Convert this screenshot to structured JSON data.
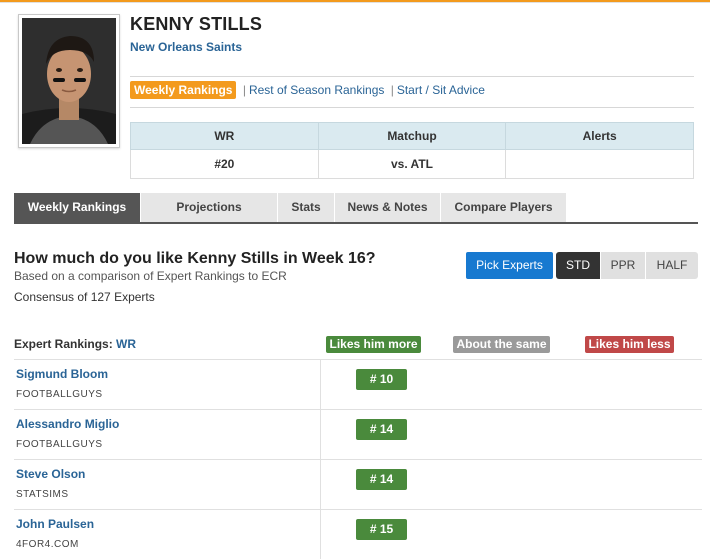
{
  "player": {
    "name": "KENNY STILLS",
    "team": "New Orleans Saints"
  },
  "sub_nav": {
    "active": "Weekly Rankings",
    "links": [
      "Rest of Season Rankings",
      "Start / Sit Advice"
    ],
    "separator": "|"
  },
  "info_table": {
    "headers": [
      "WR",
      "Matchup",
      "Alerts"
    ],
    "values": [
      "#20",
      "vs. ATL",
      ""
    ]
  },
  "tabs": [
    "Weekly Rankings",
    "Projections",
    "Stats",
    "News & Notes",
    "Compare Players"
  ],
  "question": "How much do you like Kenny Stills in Week 16?",
  "based_on": "Based on a comparison of Expert Rankings to ECR",
  "consensus": "Consensus of 127 Experts",
  "pick_experts_label": "Pick Experts",
  "scoring": [
    "STD",
    "PPR",
    "HALF"
  ],
  "experts_header": {
    "label": "Expert Rankings:",
    "position": "WR"
  },
  "badges": {
    "more": "Likes him more",
    "same": "About the same",
    "less": "Likes him less"
  },
  "experts": [
    {
      "name": "Sigmund Bloom",
      "site": "FOOTBALLGUYS",
      "rank": "# 10"
    },
    {
      "name": "Alessandro Miglio",
      "site": "FOOTBALLGUYS",
      "rank": "# 14"
    },
    {
      "name": "Steve Olson",
      "site": "STATSIMS",
      "rank": "# 14"
    },
    {
      "name": "John Paulsen",
      "site": "4FOR4.COM",
      "rank": "# 15"
    }
  ],
  "colors": {
    "accent_orange": "#f39a1d",
    "link_blue": "#2a6496",
    "pick_blue": "#1779d0",
    "likes_more_green": "#4a8a3c",
    "same_gray": "#9a9a9a",
    "likes_less_red": "#c04848",
    "table_header": "#daeaf0"
  },
  "icons": {
    "player_photo": "player-headshot"
  }
}
